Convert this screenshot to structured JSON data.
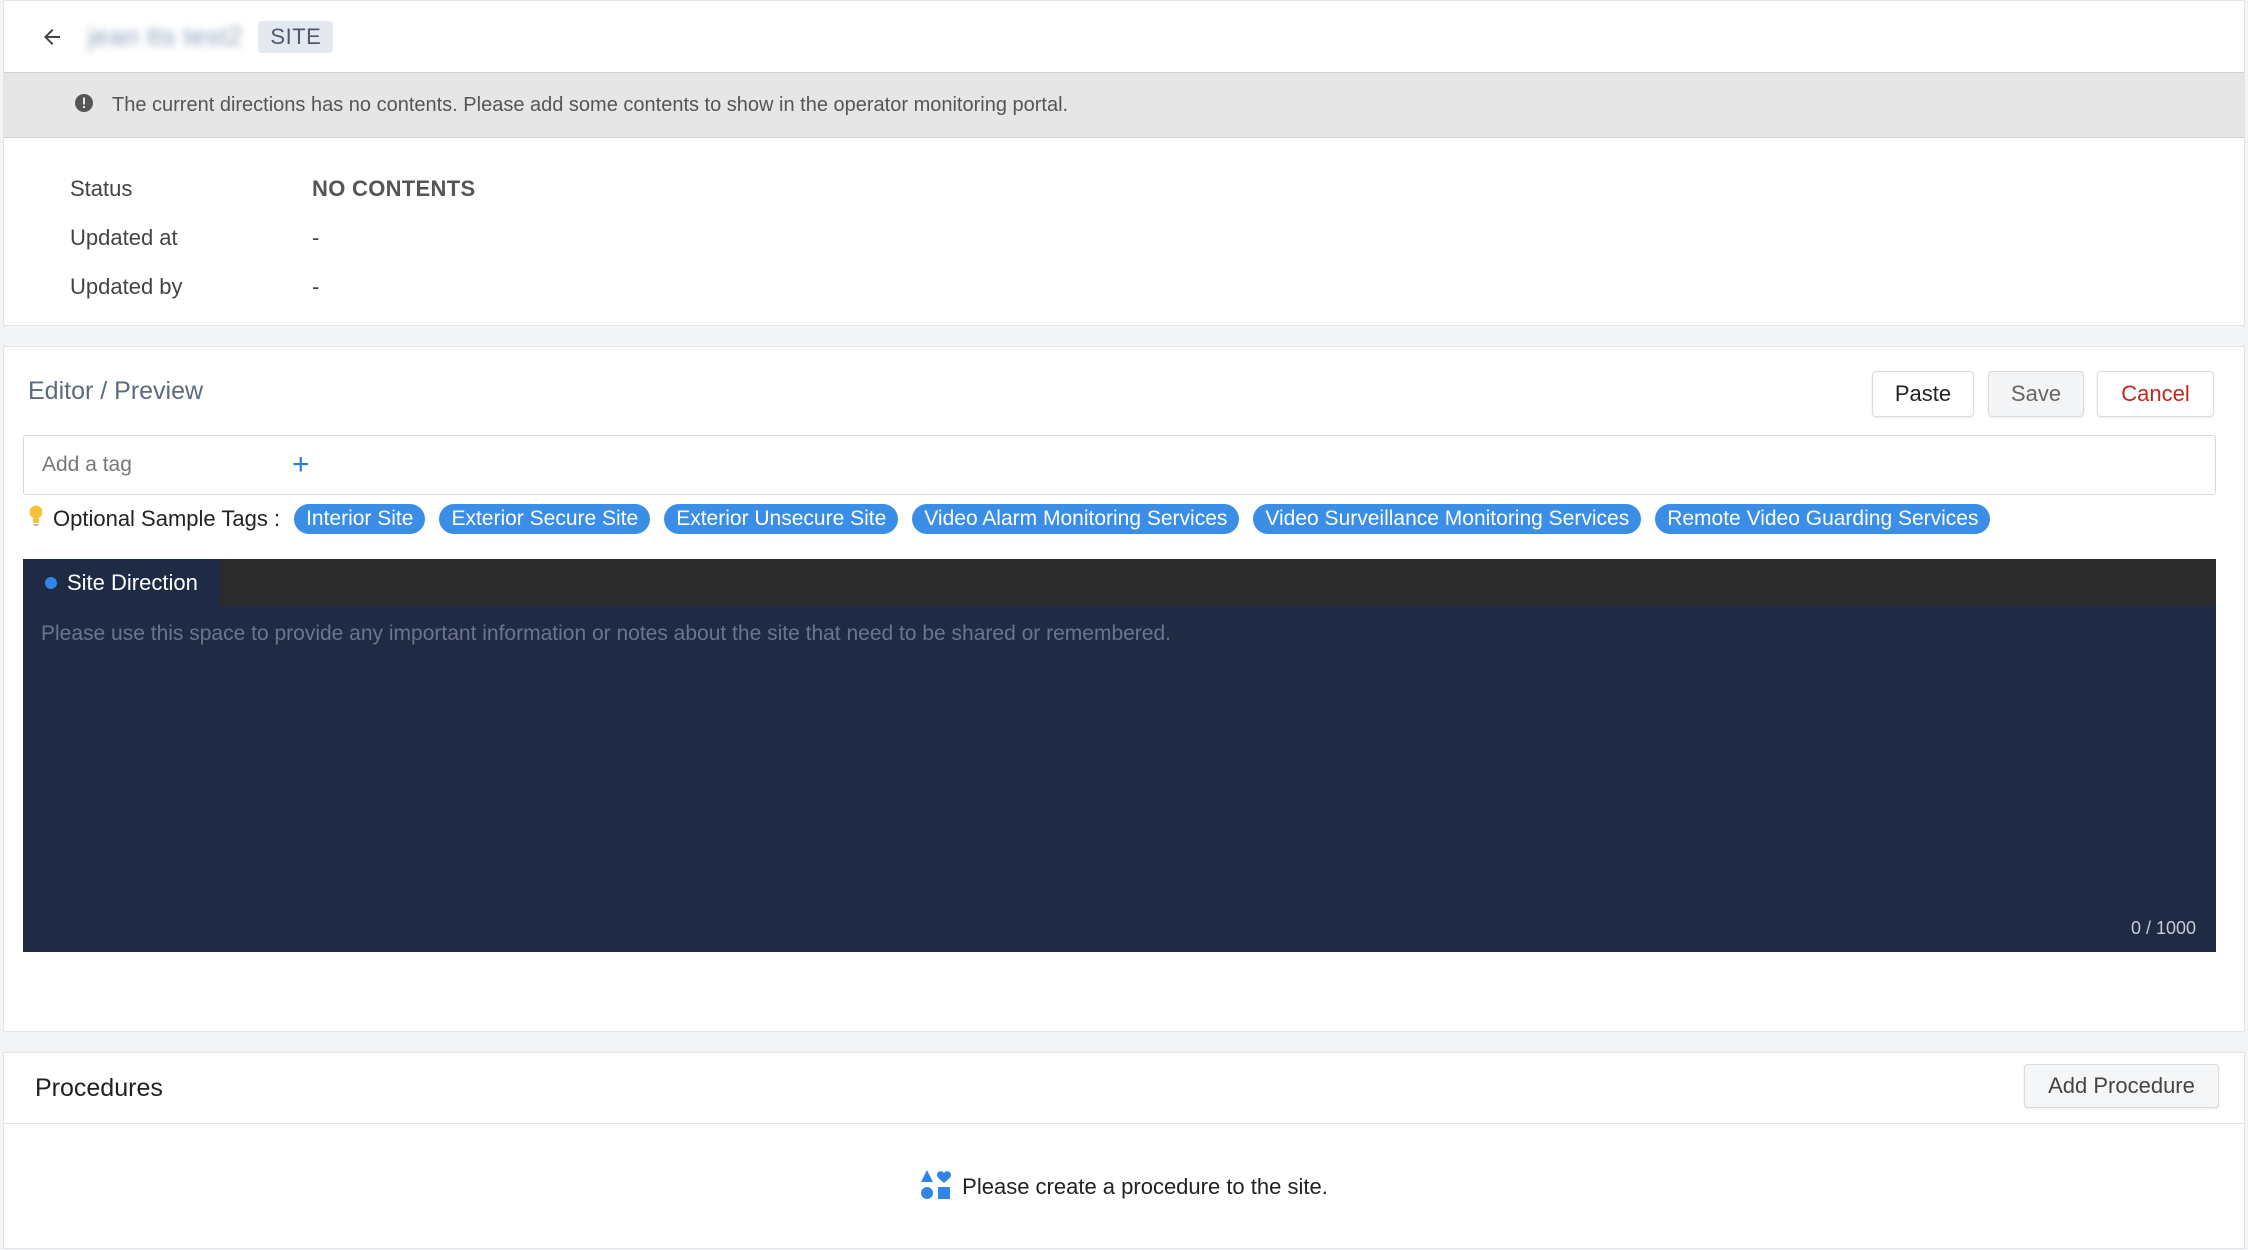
{
  "header": {
    "site_name": "jean tts test2",
    "badge": "SITE"
  },
  "notice": {
    "text": "The current directions has no contents. Please add some contents to show in the operator monitoring portal."
  },
  "info": {
    "status_label": "Status",
    "status_value": "NO CONTENTS",
    "updated_at_label": "Updated at",
    "updated_at_value": "-",
    "updated_by_label": "Updated by",
    "updated_by_value": "-"
  },
  "editor": {
    "title": "Editor / Preview",
    "paste_label": "Paste",
    "save_label": "Save",
    "cancel_label": "Cancel",
    "tag_placeholder": "Add a tag",
    "add_tag_symbol": "+",
    "sample_tags_label": "Optional Sample Tags :",
    "sample_tags": [
      "Interior Site",
      "Exterior Secure Site",
      "Exterior Unsecure Site",
      "Video Alarm Monitoring Services",
      "Video Surveillance Monitoring Services",
      "Remote Video Guarding Services"
    ],
    "tab_label": "Site Direction",
    "text_placeholder": "Please use this space to provide any important information or notes about the site that need to be shared or remembered.",
    "char_count": "0 / 1000"
  },
  "procedures": {
    "title": "Procedures",
    "add_label": "Add Procedure",
    "empty_text": "Please create a procedure to the site."
  },
  "colors": {
    "accent": "#3a8ee6",
    "cancel": "#c0271d",
    "editor_bg": "#1f2a44",
    "tab_bar_bg": "#2b2b2b",
    "notice_bg": "#e6e6e6"
  },
  "icons": {
    "back": "arrow-left-icon",
    "notice": "info-circle-icon",
    "add_tag": "plus-icon",
    "sample_tags": "lightbulb-icon",
    "empty_procedures": "shapes-icon"
  }
}
